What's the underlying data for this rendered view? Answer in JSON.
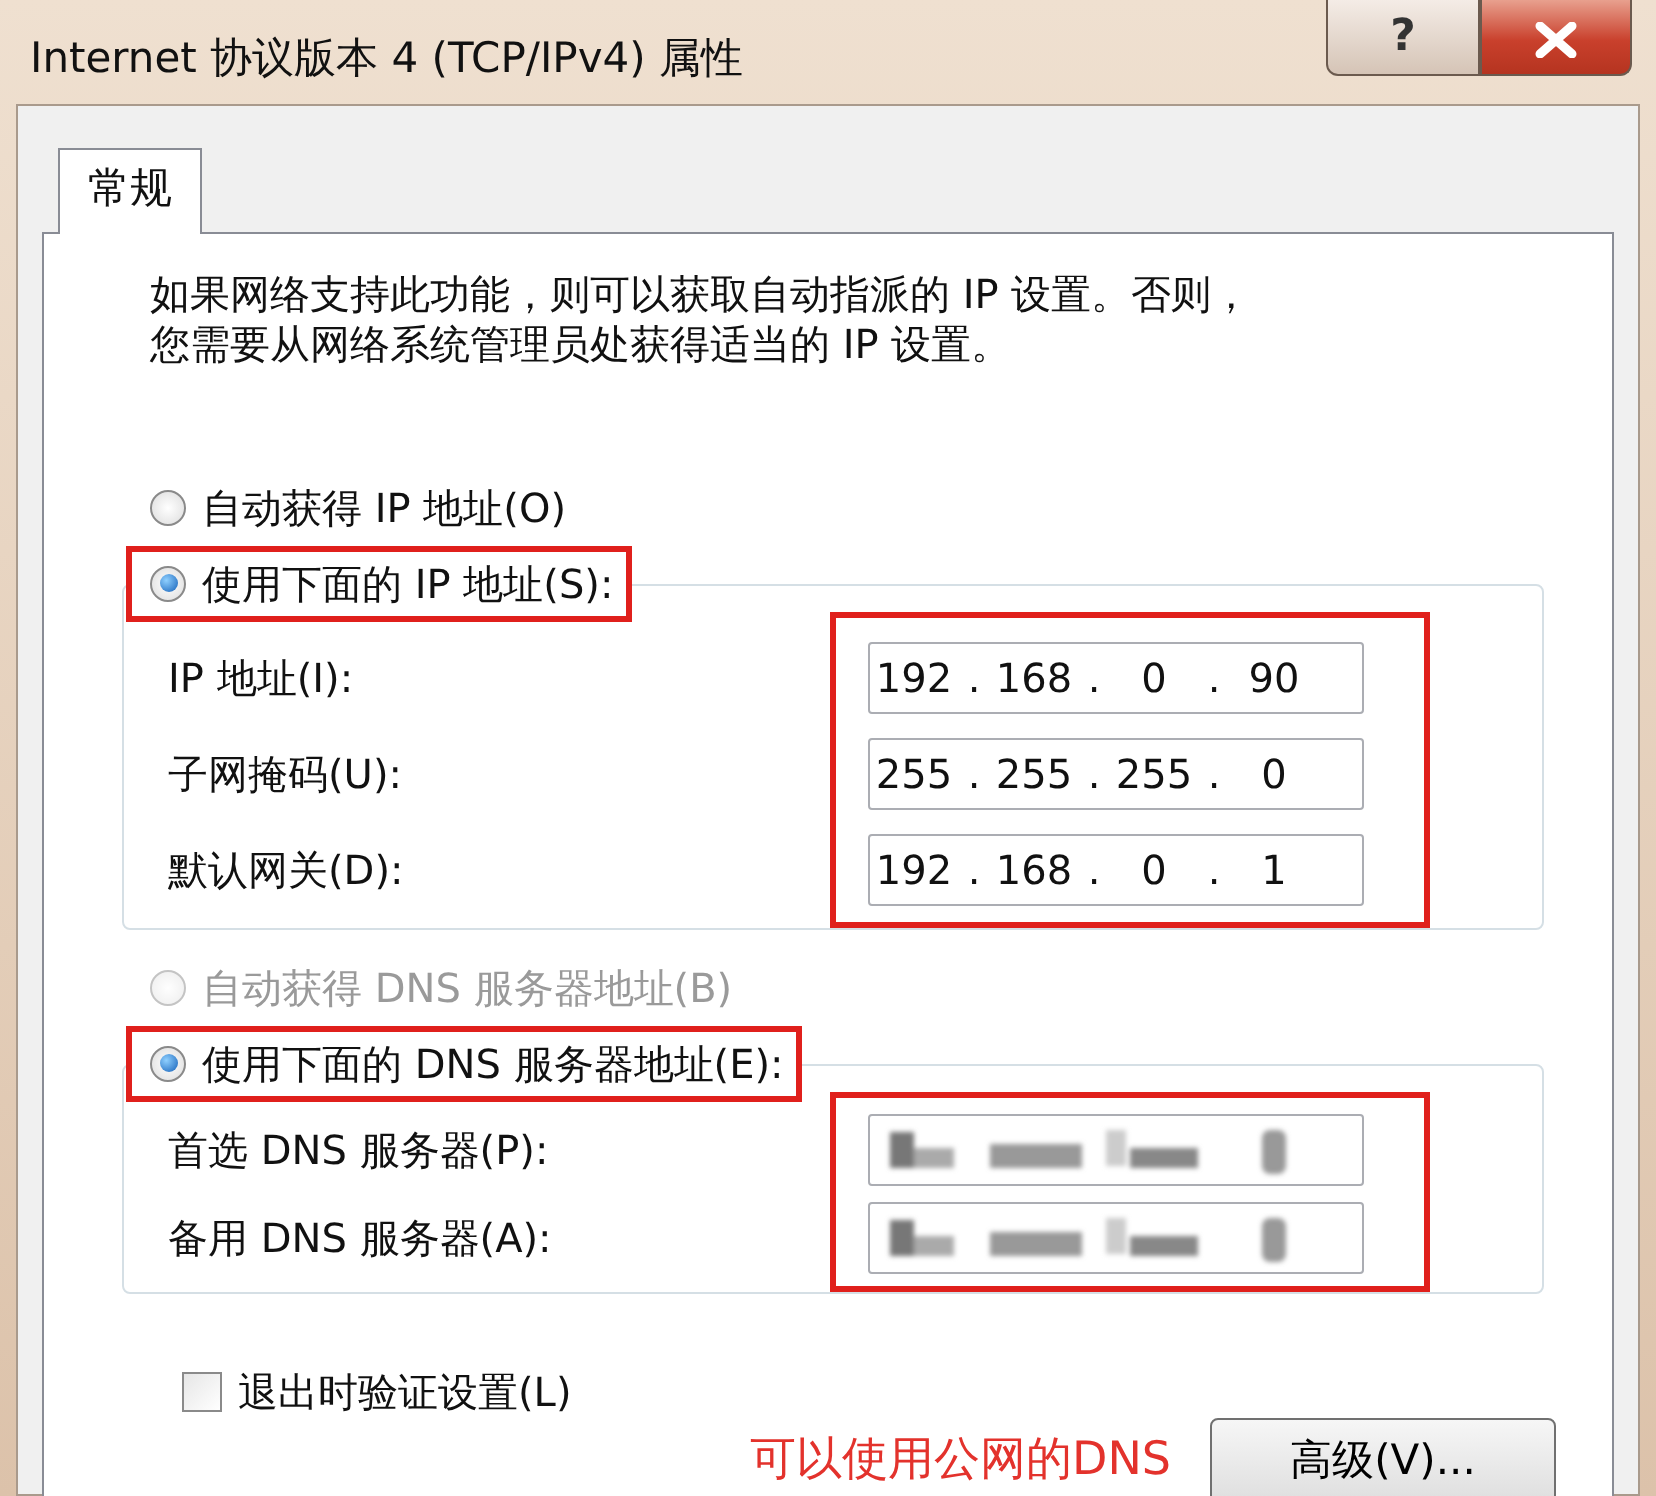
{
  "window": {
    "title": "Internet 协议版本 4 (TCP/IPv4) 属性",
    "help_label": "?"
  },
  "tabs": [
    {
      "label": "常规",
      "selected": true
    }
  ],
  "description": [
    "如果网络支持此功能，则可以获取自动指派的 IP 设置。否则，",
    "您需要从网络系统管理员处获得适当的 IP 设置。"
  ],
  "ip_separator": ".",
  "sections": [
    {
      "radios": [
        {
          "label": "自动获得 IP 地址(O)",
          "selected": false,
          "disabled": false,
          "highlighted": false
        },
        {
          "label": "使用下面的 IP 地址(S):",
          "selected": true,
          "disabled": false,
          "highlighted": true
        }
      ],
      "fields_highlighted": true,
      "fields": [
        {
          "label": "IP 地址(I):",
          "kind": "address",
          "octets": [
            "192",
            "168",
            "0",
            "90"
          ]
        },
        {
          "label": "子网掩码(U):",
          "kind": "address",
          "octets": [
            "255",
            "255",
            "255",
            "0"
          ]
        },
        {
          "label": "默认网关(D):",
          "kind": "address",
          "octets": [
            "192",
            "168",
            "0",
            "1"
          ]
        }
      ]
    },
    {
      "radios": [
        {
          "label": "自动获得 DNS 服务器地址(B)",
          "selected": false,
          "disabled": true,
          "highlighted": false
        },
        {
          "label": "使用下面的 DNS 服务器地址(E):",
          "selected": true,
          "disabled": false,
          "highlighted": true
        }
      ],
      "fields_highlighted": true,
      "fields": [
        {
          "label": "首选 DNS 服务器(P):",
          "kind": "redacted"
        },
        {
          "label": "备用 DNS 服务器(A):",
          "kind": "redacted"
        }
      ]
    }
  ],
  "checkbox": {
    "label": "退出时验证设置(L)",
    "checked": false
  },
  "advanced_button": "高级(V)...",
  "annotation": "可以使用公网的DNS"
}
